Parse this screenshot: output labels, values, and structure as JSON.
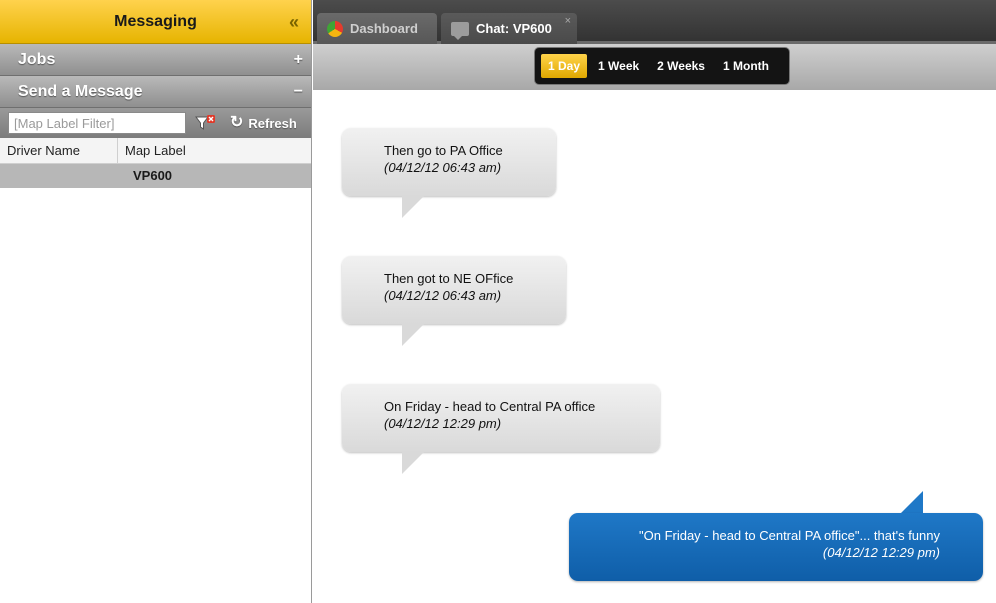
{
  "sidebar": {
    "title": "Messaging",
    "collapse_glyph": "«",
    "sections": [
      {
        "label": "Jobs",
        "sign": "+"
      },
      {
        "label": "Send a Message",
        "sign": "−"
      }
    ],
    "filter": {
      "placeholder": "[Map Label Filter]",
      "value": ""
    },
    "refresh_label": "Refresh",
    "table": {
      "columns": [
        "Driver Name",
        "Map Label"
      ],
      "rows": [
        {
          "driver": "",
          "map_label": "VP600"
        }
      ]
    }
  },
  "tabs": [
    {
      "label": "Dashboard",
      "icon": "dashboard-pie-icon"
    },
    {
      "label": "Chat: VP600",
      "icon": "chat-bubble-icon",
      "close": "×",
      "active": true
    }
  ],
  "range": {
    "options": [
      "1 Day",
      "1 Week",
      "2 Weeks",
      "1 Month"
    ],
    "selected": "1 Day"
  },
  "messages": [
    {
      "direction": "incoming",
      "text": "Then go to PA Office",
      "time": "(04/12/12 06:43 am)"
    },
    {
      "direction": "incoming",
      "text": "Then got to NE OFfice",
      "time": "(04/12/12 06:43 am)"
    },
    {
      "direction": "incoming",
      "text": "On Friday - head to Central PA office",
      "time": "(04/12/12 12:29 pm)"
    },
    {
      "direction": "outgoing",
      "text": "\"On Friday - head to Central PA office\"... that's funny",
      "time": "(04/12/12 12:29 pm)"
    }
  ],
  "colors": {
    "accent_yellow": "#f5c400",
    "outgoing_blue": "#1f78c7",
    "incoming_gray": "#e3e3e3",
    "selected_row": "#b7b7b7"
  }
}
